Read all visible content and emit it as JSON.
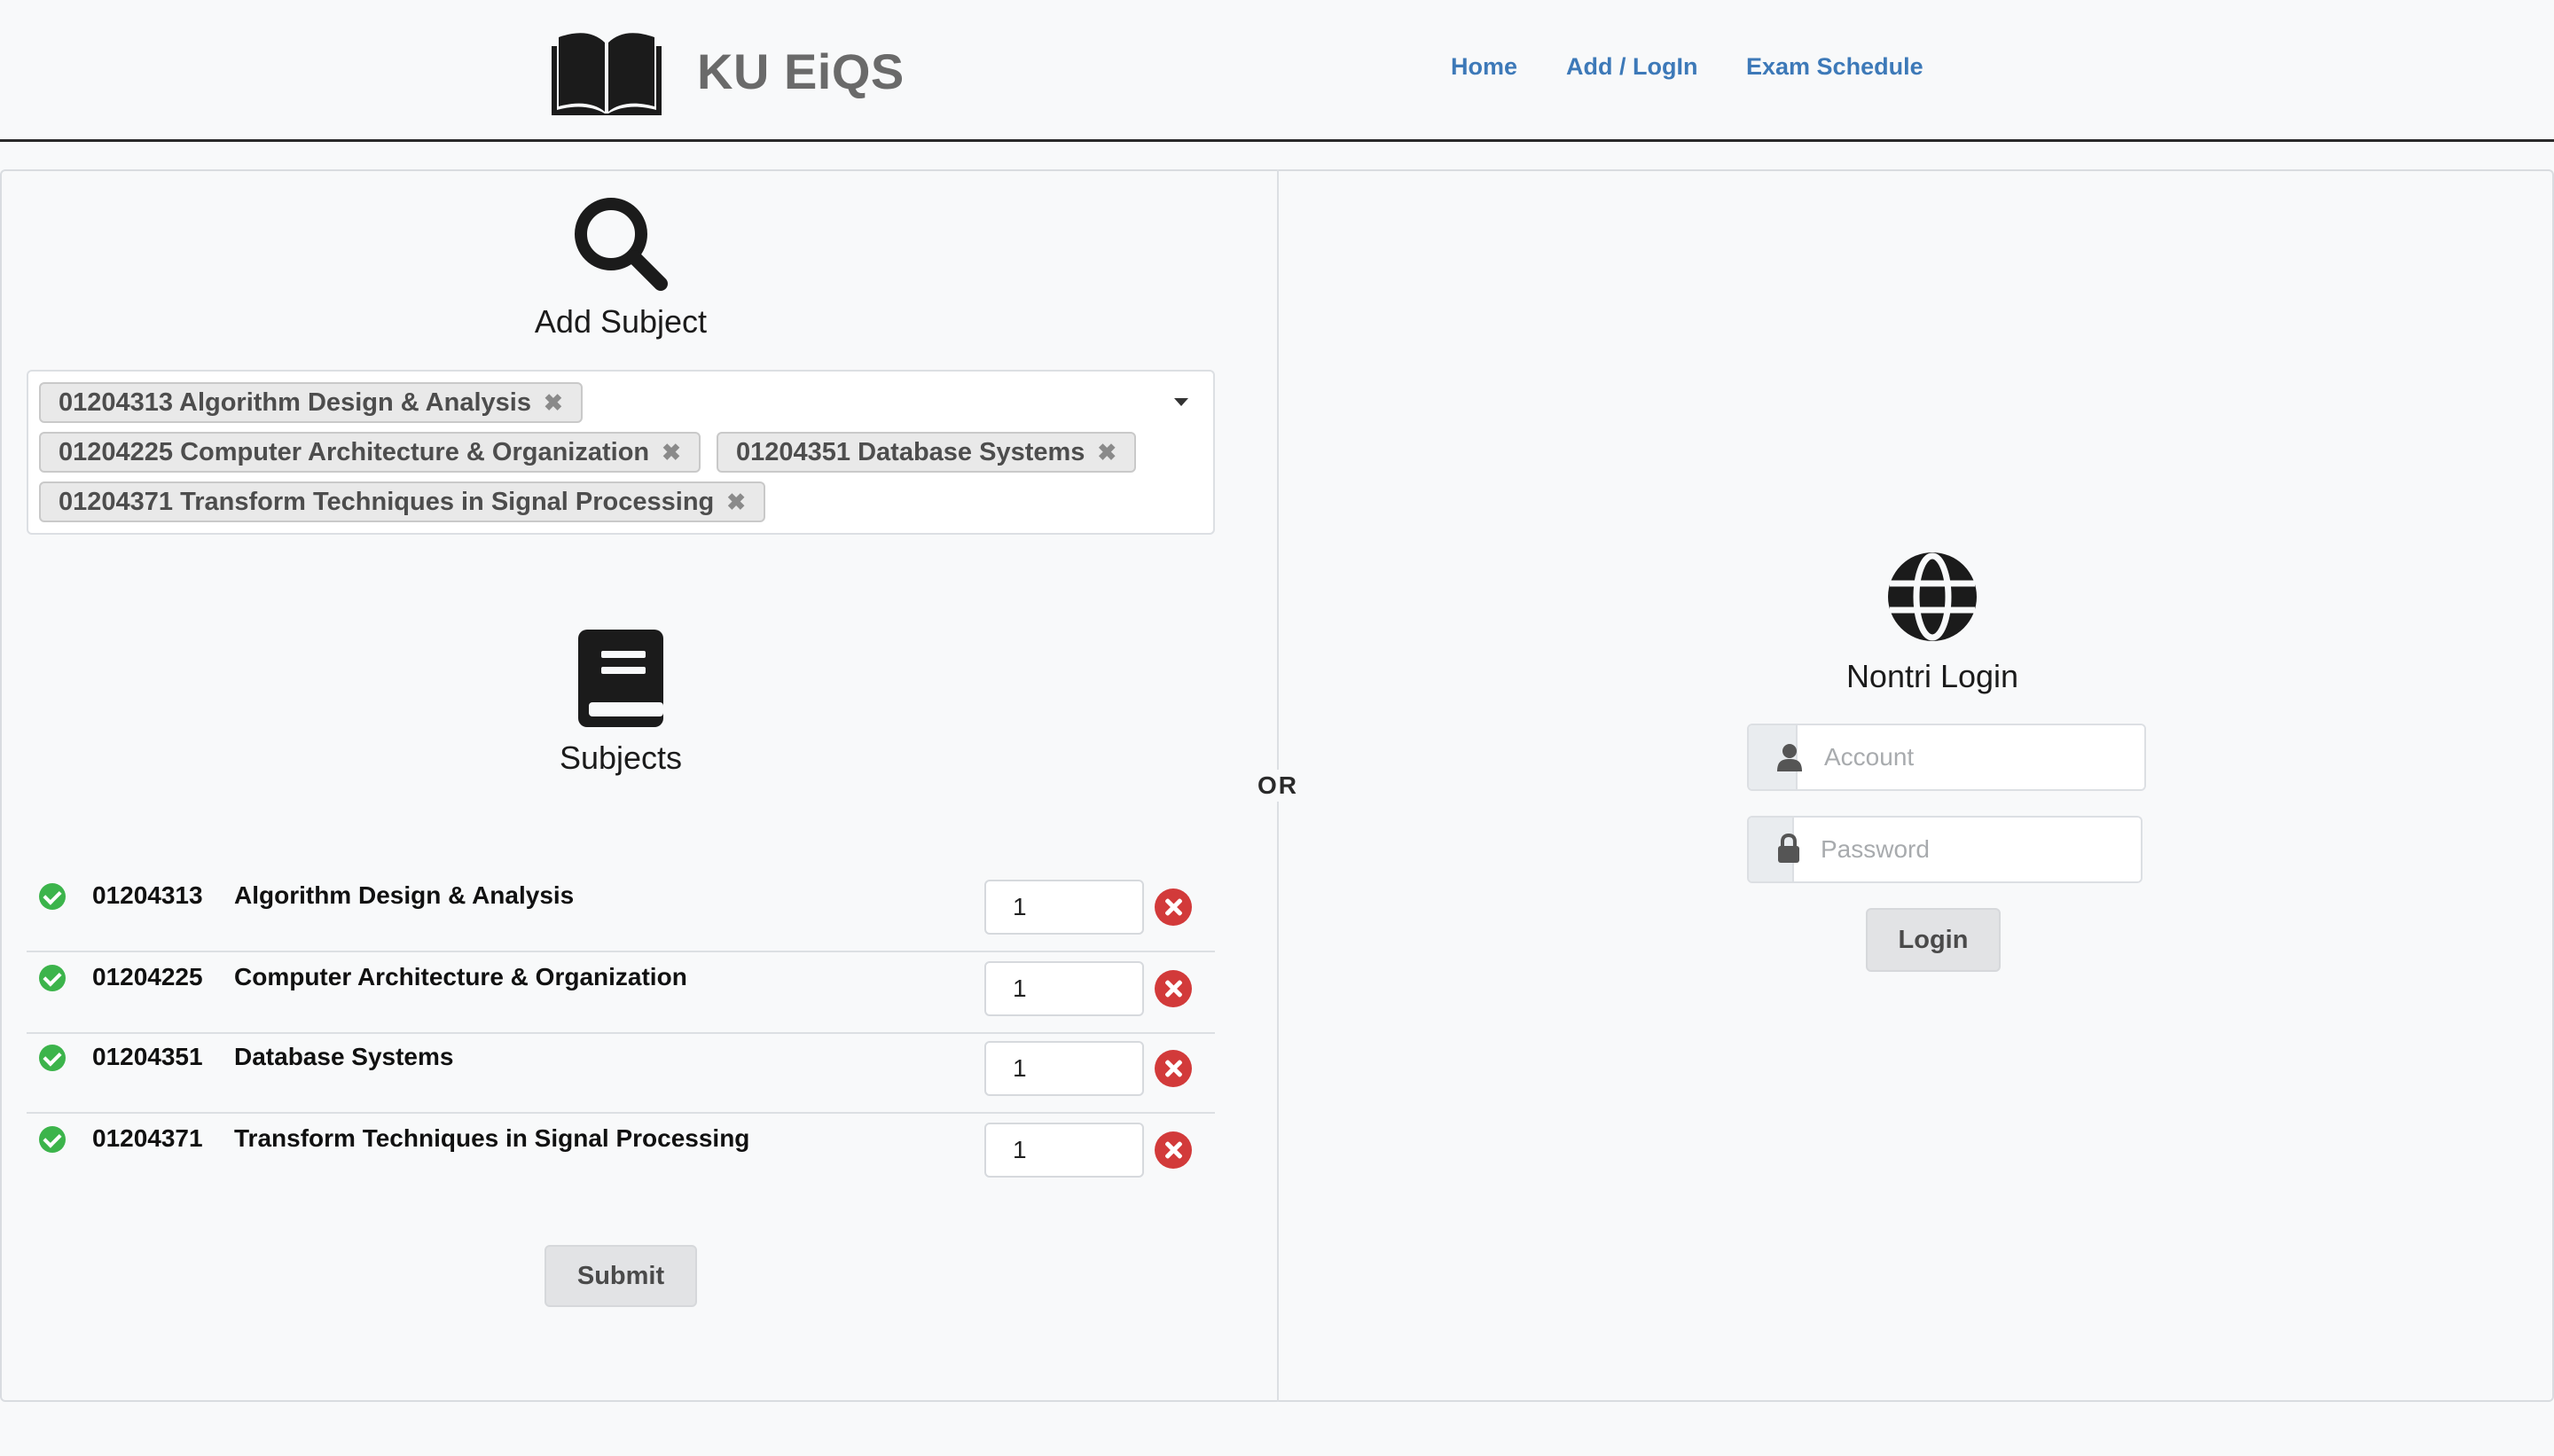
{
  "header": {
    "brand": "KU EiQS",
    "nav": [
      {
        "label": "Home"
      },
      {
        "label": "Add / LogIn"
      },
      {
        "label": "Exam Schedule"
      }
    ]
  },
  "add_subject": {
    "title": "Add Subject",
    "selected_tags": [
      {
        "label": "01204313 Algorithm Design & Analysis",
        "remove": "✖"
      },
      {
        "label": "01204225 Computer Architecture & Organization",
        "remove": "✖"
      },
      {
        "label": "01204351 Database Systems",
        "remove": "✖"
      },
      {
        "label": "01204371 Transform Techniques in Signal Processing",
        "remove": "✖"
      }
    ]
  },
  "subjects": {
    "title": "Subjects",
    "rows": [
      {
        "code": "01204313",
        "name": "Algorithm Design & Analysis",
        "qty": "1"
      },
      {
        "code": "01204225",
        "name": "Computer Architecture & Organization",
        "qty": "1"
      },
      {
        "code": "01204351",
        "name": "Database Systems",
        "qty": "1"
      },
      {
        "code": "01204371",
        "name": "Transform Techniques in Signal Processing",
        "qty": "1"
      }
    ],
    "submit_label": "Submit"
  },
  "separator": "OR",
  "login": {
    "title": "Nontri Login",
    "account_placeholder": "Account",
    "password_placeholder": "Password",
    "login_label": "Login"
  },
  "icons": {
    "brand": "open-book-icon",
    "add_subject": "search-icon",
    "subjects": "book-icon",
    "login": "globe-icon",
    "account": "user-icon",
    "password": "lock-icon"
  },
  "colors": {
    "nav_link": "#3d79b8",
    "check": "#3cb44b",
    "remove": "#d23a3a",
    "brand_text": "#6a6a6a"
  }
}
